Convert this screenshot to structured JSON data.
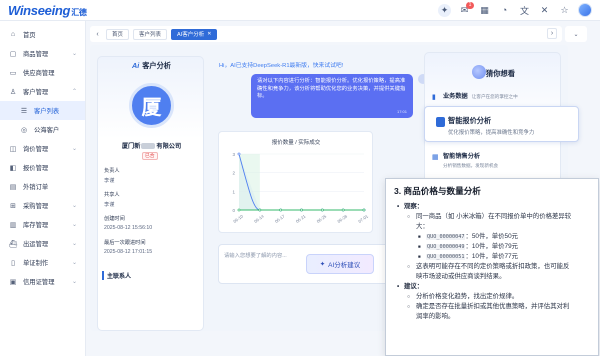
{
  "app": {
    "logo_text": "Winseeing",
    "logo_sub": "汇德"
  },
  "topbar": {
    "notif_count": "1"
  },
  "sidebar": {
    "items": [
      {
        "label": "首页",
        "icon": "home-icon"
      },
      {
        "label": "商品管理",
        "icon": "box-icon"
      },
      {
        "label": "供应商管理",
        "icon": "truck-icon"
      },
      {
        "label": "客户管理",
        "icon": "users-icon"
      },
      {
        "label": "客户列表",
        "icon": "list-icon"
      },
      {
        "label": "公海客户",
        "icon": "globe-icon"
      },
      {
        "label": "询价管理",
        "icon": "inquiry-icon"
      },
      {
        "label": "报价管理",
        "icon": "quote-icon"
      },
      {
        "label": "外销订单",
        "icon": "order-icon"
      },
      {
        "label": "采购管理",
        "icon": "cart-icon"
      },
      {
        "label": "库存管理",
        "icon": "warehouse-icon"
      },
      {
        "label": "出运管理",
        "icon": "ship-icon"
      },
      {
        "label": "单证制作",
        "icon": "doc-icon"
      },
      {
        "label": "信用证管理",
        "icon": "credit-icon"
      }
    ]
  },
  "tabs": {
    "items": [
      "首页",
      "客户列表",
      "AI客户分析"
    ]
  },
  "customer": {
    "panel_title": "客户分析",
    "avatar_char": "厦",
    "name_prefix": "厦门新",
    "name_suffix": "有限公司",
    "tag": "已合",
    "owner_label": "负责人",
    "owner_value": "李谨",
    "sharer_label": "共享人",
    "sharer_value": "李谨",
    "created_label": "创建时间",
    "created_value": "2025-08-12 15:56:10",
    "followup_label": "最后一次跟进时间",
    "followup_value": "2025-08-12 17:01:15",
    "contact_title": "主联系人"
  },
  "chat": {
    "greeting": "Hi，AI已支持DeepSeek-R1最新版，快来试试吧!",
    "bubble_text": "请对以下内容进行分析：智能报价分析。优化报价策略，提高准确性和竞争力，该分析将帮助优化您的业务决策，并提供关键指标。",
    "bubble_time": "17:01",
    "input_placeholder": "请输入您想要了解的内容...",
    "ai_button": "AI分析建议"
  },
  "chart_data": {
    "type": "line",
    "title": "报价数量 / 实际成交",
    "x": [
      "06-10",
      "06-14",
      "06-17",
      "06-21",
      "06-25",
      "06-28",
      "07-01"
    ],
    "series": [
      {
        "values": [
          3,
          0,
          0,
          0,
          0,
          0,
          0
        ],
        "color": "#4f7ff0"
      },
      {
        "values": [
          0,
          0,
          0,
          0,
          0,
          0,
          0
        ],
        "color": "#35b86b"
      }
    ],
    "ylim": [
      0,
      3
    ],
    "yticks": [
      "0",
      "1",
      "2",
      "3"
    ]
  },
  "guess": {
    "title": "猜你想看",
    "items": [
      {
        "title": "业务数据",
        "desc": "让客户在您的掌控之中"
      },
      {
        "title": "智能报价分析",
        "desc": "优化报价策略，提高准确性和竞争力"
      },
      {
        "title": "智能销售分析",
        "desc": "分析销售数据，发现新机会"
      }
    ]
  },
  "popup": {
    "title": "3. 商品价格与数量分析",
    "obs_label": "观察：",
    "obs_line1": "同一商品（如 小米冰箱）在不同报价单中的价格差异较",
    "obs_line2": "大：",
    "quotes": [
      {
        "code": "QUO_00000047",
        "text": "：50件，单价50元"
      },
      {
        "code": "QUO_00000049",
        "text": "：10件，单价79元"
      },
      {
        "code": "QUO_00000051",
        "text": "：10件，单价77元"
      }
    ],
    "obs_line3": "这表明可能存在不同的定价策略或折扣政策，也可能反",
    "obs_line4": "映市场波动或供应商谈判结果。",
    "sug_label": "建议：",
    "sug_line1": "分析价格变化趋势，找出定价规律。",
    "sug_line2": "确定是否存在批量折扣或其他优惠策略，并评估其对利",
    "sug_line3": "润率的影响。"
  }
}
